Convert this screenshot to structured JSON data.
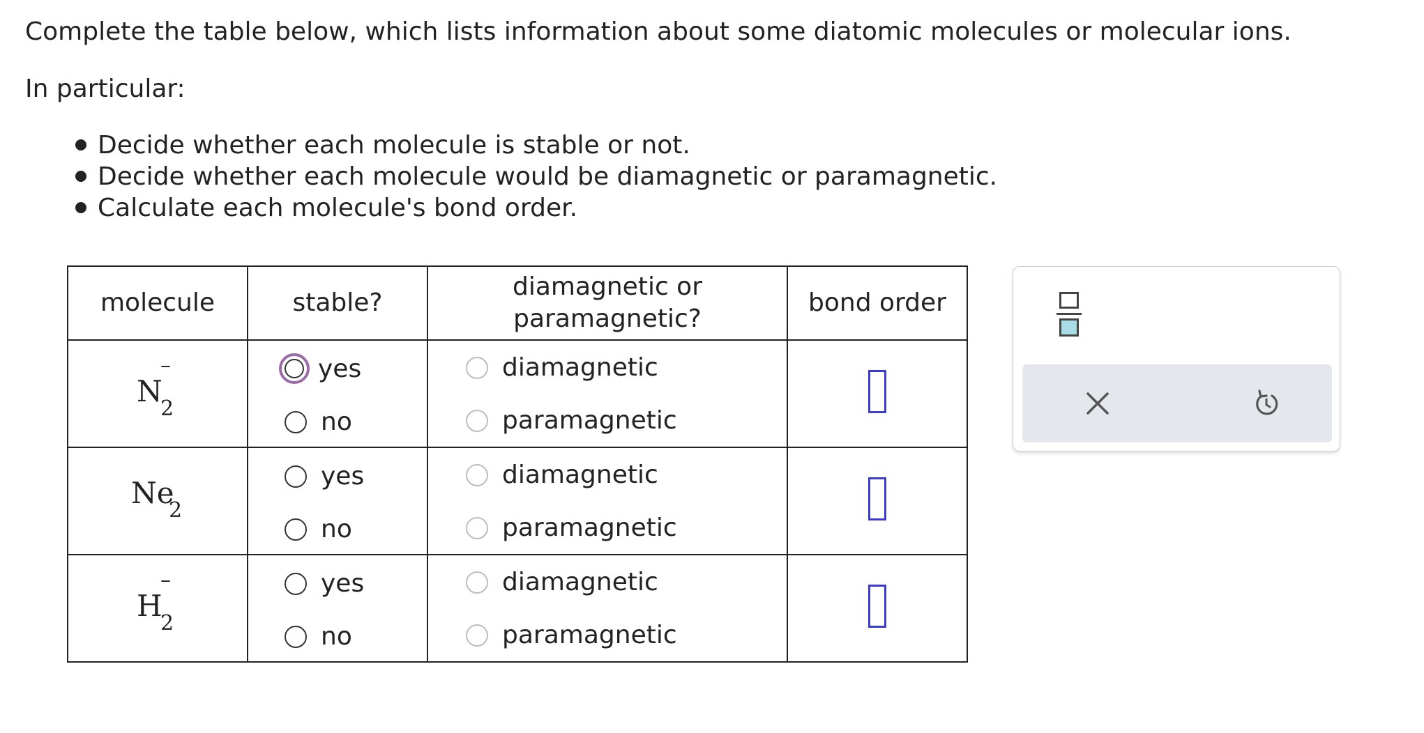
{
  "instructions": {
    "intro": "Complete the table below, which lists information about some diatomic molecules or molecular ions.",
    "particular": "In particular:",
    "bullets": [
      "Decide whether each molecule is stable or not.",
      "Decide whether each molecule would be diamagnetic or paramagnetic.",
      "Calculate each molecule's bond order."
    ]
  },
  "table": {
    "headers": {
      "molecule": "molecule",
      "stable": "stable?",
      "magnetic_line1": "diamagnetic or",
      "magnetic_line2": "paramagnetic?",
      "bond_order": "bond order"
    },
    "rows": [
      {
        "molecule": {
          "base": "N",
          "sub": "2",
          "sup": "–"
        },
        "stable_yes": "yes",
        "stable_no": "no",
        "mag_dia": "diamagnetic",
        "mag_para": "paramagnetic",
        "stable_focused": "yes",
        "bond_order": ""
      },
      {
        "molecule": {
          "base": "Ne",
          "sub": "2",
          "sup": ""
        },
        "stable_yes": "yes",
        "stable_no": "no",
        "mag_dia": "diamagnetic",
        "mag_para": "paramagnetic",
        "bond_order": ""
      },
      {
        "molecule": {
          "base": "H",
          "sub": "2",
          "sup": "–"
        },
        "stable_yes": "yes",
        "stable_no": "no",
        "mag_dia": "diamagnetic",
        "mag_para": "paramagnetic",
        "bond_order": ""
      }
    ]
  },
  "panel": {
    "icons": [
      "fraction-icon",
      "clear-icon",
      "undo-icon"
    ]
  },
  "colors": {
    "focus_ring": "#9b6aa8",
    "answer_box": "#3b3bd1",
    "fraction_fill": "#a9dde6",
    "toolbar_bg": "#e4e8ec"
  }
}
